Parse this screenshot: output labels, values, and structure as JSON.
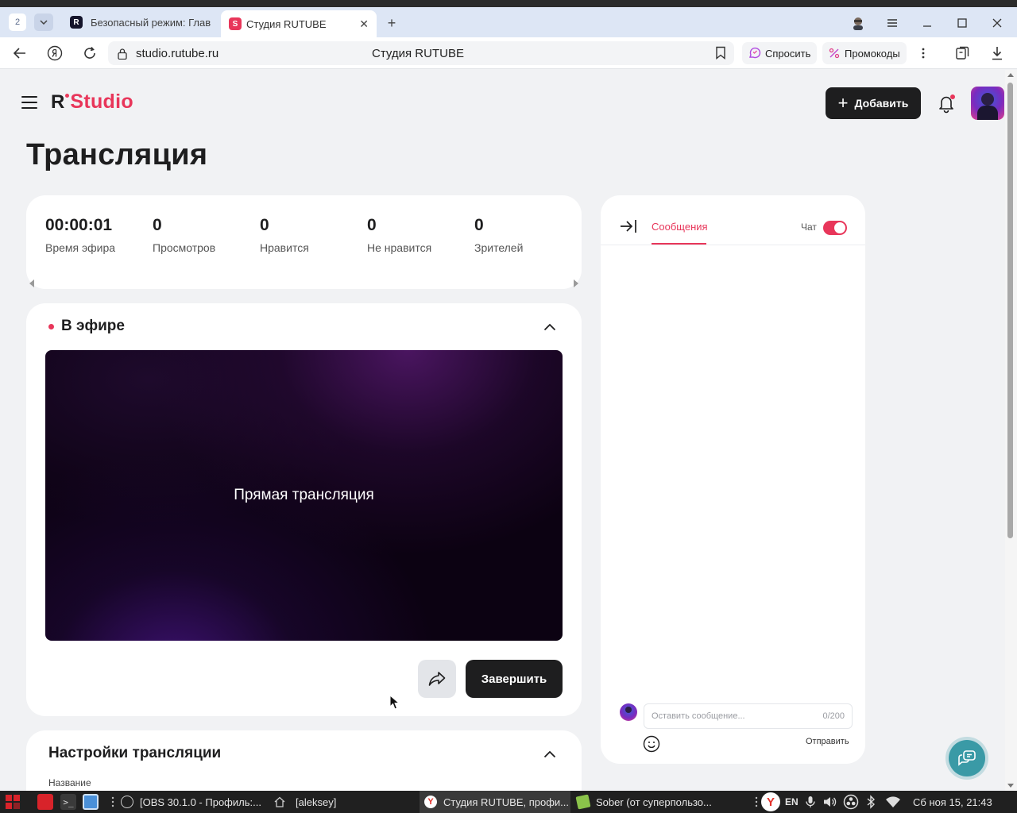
{
  "browser": {
    "tab_count": "2",
    "tabs": [
      {
        "title": "Безопасный режим: Глав",
        "favicon": "rutube-r-icon",
        "active": false
      },
      {
        "title": "Студия RUTUBE",
        "favicon": "rutube-studio-icon",
        "active": true
      }
    ],
    "url": "studio.rutube.ru",
    "page_title": "Студия RUTUBE",
    "ask_label": "Спросить",
    "promo_label": "Промокоды"
  },
  "header": {
    "logo_r": "R",
    "logo_studio": "Studio",
    "add_label": "Добавить",
    "accent": "#e8365a"
  },
  "page": {
    "title": "Трансляция"
  },
  "stats": [
    {
      "value": "00:00:01",
      "label": "Время эфира"
    },
    {
      "value": "0",
      "label": "Просмотров"
    },
    {
      "value": "0",
      "label": "Нравится"
    },
    {
      "value": "0",
      "label": "Не нравится"
    },
    {
      "value": "0",
      "label": "Зрителей"
    }
  ],
  "live": {
    "heading": "В эфире",
    "player_text": "Прямая трансляция",
    "finish_label": "Завершить"
  },
  "settings": {
    "heading": "Настройки трансляции",
    "name_label": "Название"
  },
  "chat": {
    "tab_label": "Сообщения",
    "toggle_label": "Чат",
    "toggle_on": true,
    "input_placeholder": "Оставить сообщение...",
    "char_counter": "0/200",
    "send_label": "Отправить"
  },
  "taskbar": {
    "windows": [
      {
        "title": "[OBS 30.1.0 - Профиль:...",
        "icon": "obs-icon"
      },
      {
        "title": "[aleksey]",
        "icon": "home-folder-icon"
      },
      {
        "title": "Студия RUTUBE, профи...",
        "icon": "yandex-browser-icon"
      },
      {
        "title": "Sober (от суперпользо...",
        "icon": "sober-icon"
      }
    ],
    "lang": "EN",
    "clock": "Сб ноя 15, 21:43"
  }
}
